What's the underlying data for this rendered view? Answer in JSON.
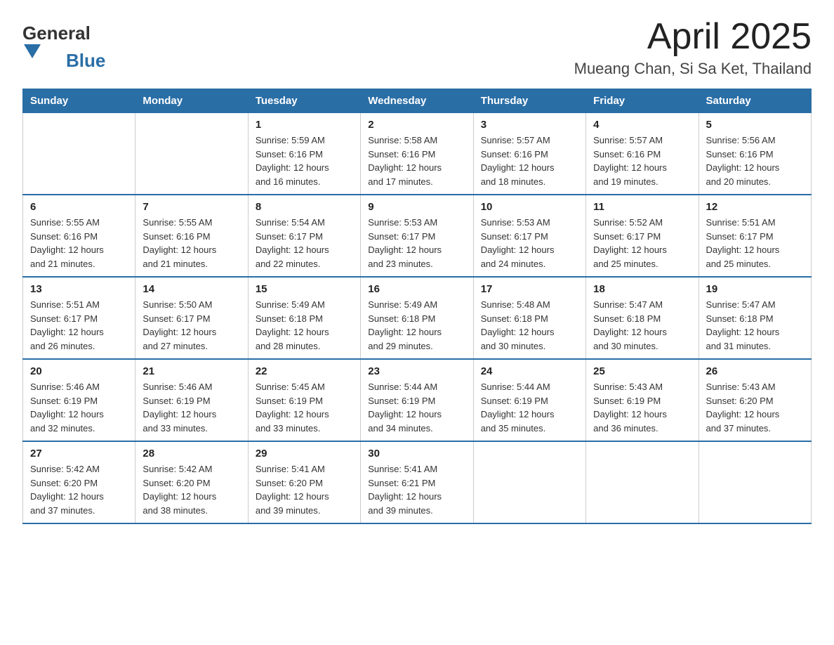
{
  "header": {
    "logo_general": "General",
    "logo_blue": "Blue",
    "title": "April 2025",
    "subtitle": "Mueang Chan, Si Sa Ket, Thailand"
  },
  "days_of_week": [
    "Sunday",
    "Monday",
    "Tuesday",
    "Wednesday",
    "Thursday",
    "Friday",
    "Saturday"
  ],
  "weeks": [
    [
      {
        "day": "",
        "info": ""
      },
      {
        "day": "",
        "info": ""
      },
      {
        "day": "1",
        "info": "Sunrise: 5:59 AM\nSunset: 6:16 PM\nDaylight: 12 hours\nand 16 minutes."
      },
      {
        "day": "2",
        "info": "Sunrise: 5:58 AM\nSunset: 6:16 PM\nDaylight: 12 hours\nand 17 minutes."
      },
      {
        "day": "3",
        "info": "Sunrise: 5:57 AM\nSunset: 6:16 PM\nDaylight: 12 hours\nand 18 minutes."
      },
      {
        "day": "4",
        "info": "Sunrise: 5:57 AM\nSunset: 6:16 PM\nDaylight: 12 hours\nand 19 minutes."
      },
      {
        "day": "5",
        "info": "Sunrise: 5:56 AM\nSunset: 6:16 PM\nDaylight: 12 hours\nand 20 minutes."
      }
    ],
    [
      {
        "day": "6",
        "info": "Sunrise: 5:55 AM\nSunset: 6:16 PM\nDaylight: 12 hours\nand 21 minutes."
      },
      {
        "day": "7",
        "info": "Sunrise: 5:55 AM\nSunset: 6:16 PM\nDaylight: 12 hours\nand 21 minutes."
      },
      {
        "day": "8",
        "info": "Sunrise: 5:54 AM\nSunset: 6:17 PM\nDaylight: 12 hours\nand 22 minutes."
      },
      {
        "day": "9",
        "info": "Sunrise: 5:53 AM\nSunset: 6:17 PM\nDaylight: 12 hours\nand 23 minutes."
      },
      {
        "day": "10",
        "info": "Sunrise: 5:53 AM\nSunset: 6:17 PM\nDaylight: 12 hours\nand 24 minutes."
      },
      {
        "day": "11",
        "info": "Sunrise: 5:52 AM\nSunset: 6:17 PM\nDaylight: 12 hours\nand 25 minutes."
      },
      {
        "day": "12",
        "info": "Sunrise: 5:51 AM\nSunset: 6:17 PM\nDaylight: 12 hours\nand 25 minutes."
      }
    ],
    [
      {
        "day": "13",
        "info": "Sunrise: 5:51 AM\nSunset: 6:17 PM\nDaylight: 12 hours\nand 26 minutes."
      },
      {
        "day": "14",
        "info": "Sunrise: 5:50 AM\nSunset: 6:17 PM\nDaylight: 12 hours\nand 27 minutes."
      },
      {
        "day": "15",
        "info": "Sunrise: 5:49 AM\nSunset: 6:18 PM\nDaylight: 12 hours\nand 28 minutes."
      },
      {
        "day": "16",
        "info": "Sunrise: 5:49 AM\nSunset: 6:18 PM\nDaylight: 12 hours\nand 29 minutes."
      },
      {
        "day": "17",
        "info": "Sunrise: 5:48 AM\nSunset: 6:18 PM\nDaylight: 12 hours\nand 30 minutes."
      },
      {
        "day": "18",
        "info": "Sunrise: 5:47 AM\nSunset: 6:18 PM\nDaylight: 12 hours\nand 30 minutes."
      },
      {
        "day": "19",
        "info": "Sunrise: 5:47 AM\nSunset: 6:18 PM\nDaylight: 12 hours\nand 31 minutes."
      }
    ],
    [
      {
        "day": "20",
        "info": "Sunrise: 5:46 AM\nSunset: 6:19 PM\nDaylight: 12 hours\nand 32 minutes."
      },
      {
        "day": "21",
        "info": "Sunrise: 5:46 AM\nSunset: 6:19 PM\nDaylight: 12 hours\nand 33 minutes."
      },
      {
        "day": "22",
        "info": "Sunrise: 5:45 AM\nSunset: 6:19 PM\nDaylight: 12 hours\nand 33 minutes."
      },
      {
        "day": "23",
        "info": "Sunrise: 5:44 AM\nSunset: 6:19 PM\nDaylight: 12 hours\nand 34 minutes."
      },
      {
        "day": "24",
        "info": "Sunrise: 5:44 AM\nSunset: 6:19 PM\nDaylight: 12 hours\nand 35 minutes."
      },
      {
        "day": "25",
        "info": "Sunrise: 5:43 AM\nSunset: 6:19 PM\nDaylight: 12 hours\nand 36 minutes."
      },
      {
        "day": "26",
        "info": "Sunrise: 5:43 AM\nSunset: 6:20 PM\nDaylight: 12 hours\nand 37 minutes."
      }
    ],
    [
      {
        "day": "27",
        "info": "Sunrise: 5:42 AM\nSunset: 6:20 PM\nDaylight: 12 hours\nand 37 minutes."
      },
      {
        "day": "28",
        "info": "Sunrise: 5:42 AM\nSunset: 6:20 PM\nDaylight: 12 hours\nand 38 minutes."
      },
      {
        "day": "29",
        "info": "Sunrise: 5:41 AM\nSunset: 6:20 PM\nDaylight: 12 hours\nand 39 minutes."
      },
      {
        "day": "30",
        "info": "Sunrise: 5:41 AM\nSunset: 6:21 PM\nDaylight: 12 hours\nand 39 minutes."
      },
      {
        "day": "",
        "info": ""
      },
      {
        "day": "",
        "info": ""
      },
      {
        "day": "",
        "info": ""
      }
    ]
  ]
}
